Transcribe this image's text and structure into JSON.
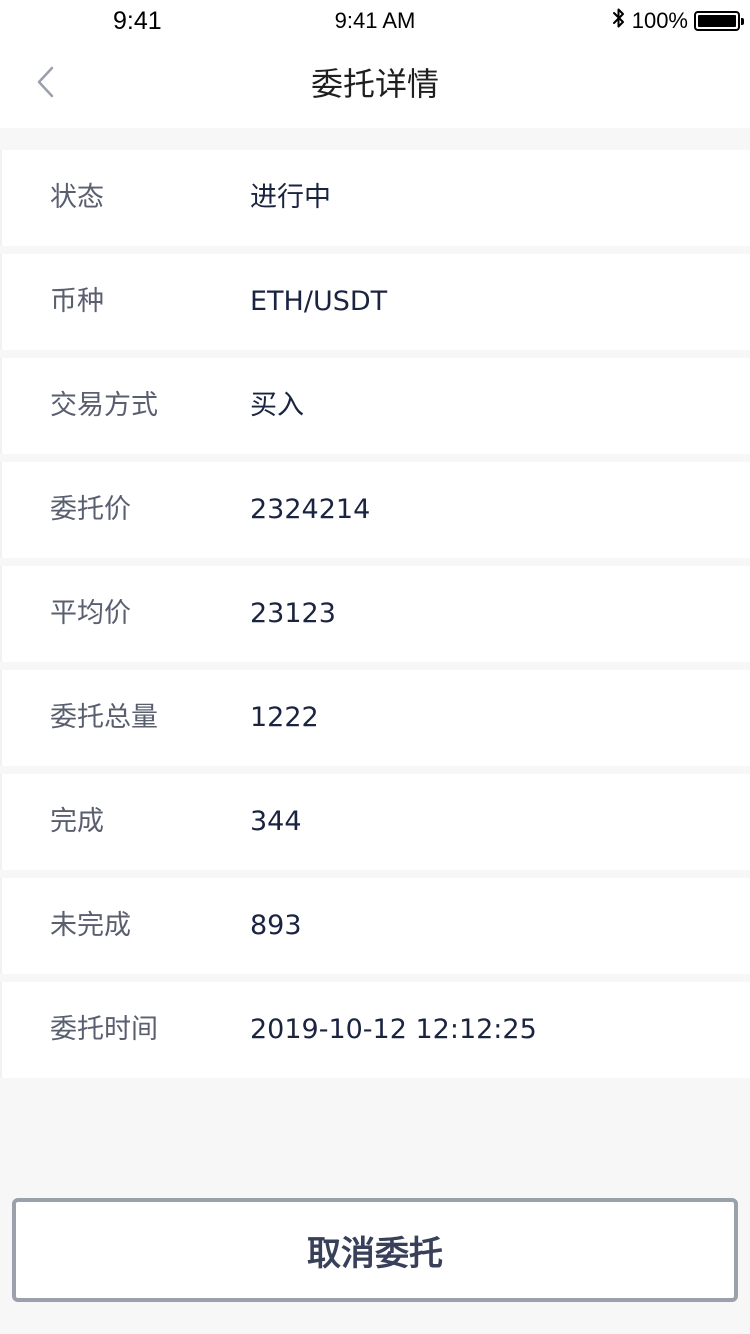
{
  "status_bar": {
    "time_left": "9:41",
    "time_center": "9:41 AM",
    "bluetooth_icon": "bluetooth-icon",
    "battery_text": "100%",
    "battery_level": 1.0
  },
  "nav": {
    "back_icon": "chevron-left-icon",
    "title": "委托详情"
  },
  "details": [
    {
      "label": "状态",
      "value": "进行中"
    },
    {
      "label": "币种",
      "value": "ETH/USDT"
    },
    {
      "label": "交易方式",
      "value": "买入"
    },
    {
      "label": "委托价",
      "value": "2324214"
    },
    {
      "label": "平均价",
      "value": "23123"
    },
    {
      "label": "委托总量",
      "value": "1222"
    },
    {
      "label": "完成",
      "value": "344"
    },
    {
      "label": "未完成",
      "value": "893"
    },
    {
      "label": "委托时间",
      "value": "2019-10-12 12:12:25"
    }
  ],
  "actions": {
    "cancel_label": "取消委托"
  },
  "colors": {
    "background": "#f7f7f7",
    "label": "#5a5f70",
    "value": "#1a2340",
    "button_border": "#9ba0ad",
    "button_text": "#39405a"
  }
}
